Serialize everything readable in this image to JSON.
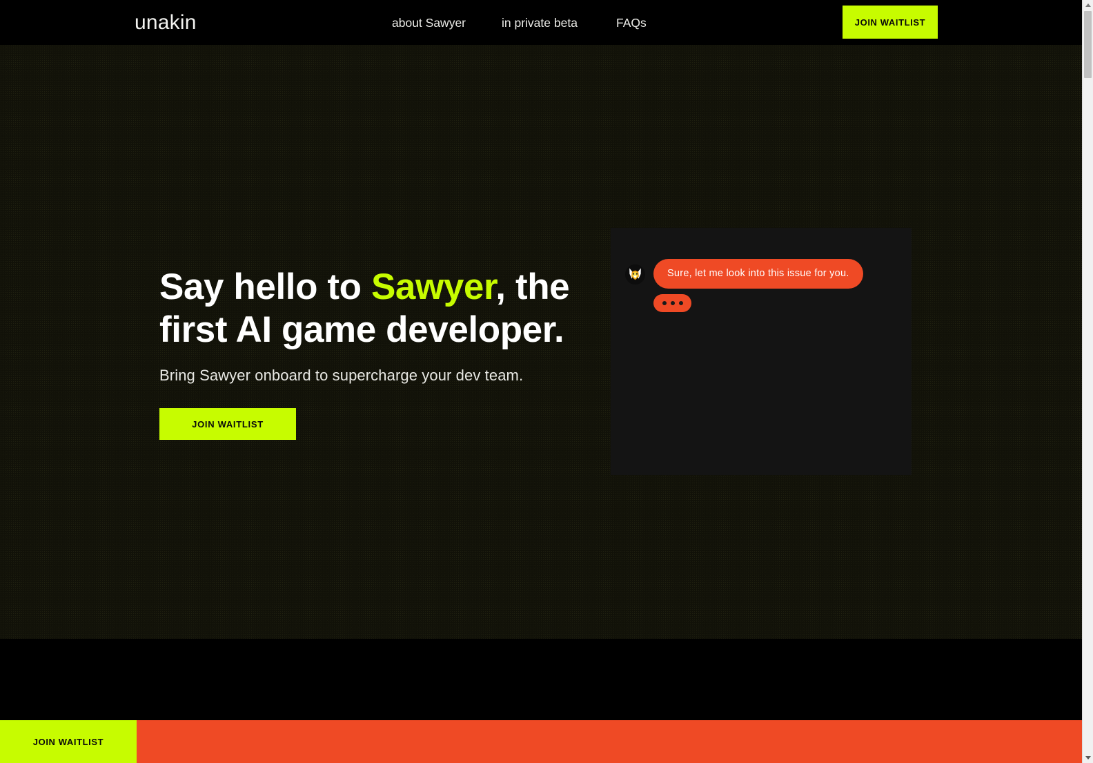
{
  "brand": {
    "logo_text": "unakin",
    "accent_lime": "#c7fc00",
    "accent_orange": "#ef4a25",
    "background_dark": "#121209",
    "panel_dark": "#141414"
  },
  "nav": {
    "links": [
      {
        "label": "about Sawyer",
        "name": "nav-link-about-sawyer"
      },
      {
        "label": "in private beta",
        "name": "nav-link-in-private-beta"
      },
      {
        "label": "FAQs",
        "name": "nav-link-faqs"
      }
    ],
    "cta_label": "JOIN WAITLIST"
  },
  "hero": {
    "headline_part1": "Say hello to ",
    "headline_accent": "Sawyer",
    "headline_part2": ", the first AI game developer.",
    "subheadline": "Bring Sawyer onboard to supercharge your dev team.",
    "cta_label": "JOIN WAITLIST"
  },
  "chat": {
    "avatar_name": "sawyer-fox-avatar-icon",
    "message": "Sure, let me look into this issue for you.",
    "typing_indicator": "•••"
  },
  "bottom_bar": {
    "cta_label": "JOIN WAITLIST"
  },
  "scrollbar": {
    "up_arrow": "scroll-up-icon",
    "down_arrow": "scroll-down-icon"
  }
}
